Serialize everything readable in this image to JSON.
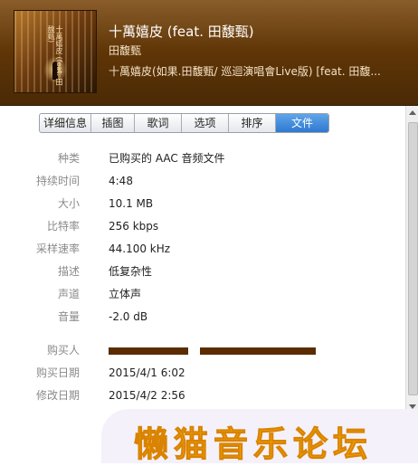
{
  "header": {
    "title": "十萬嬉皮 (feat. 田馥甄)",
    "artist": "田馥甄",
    "album": "十萬嬉皮(如果.田馥甄/ 巡迴演唱會Live版) [feat. 田馥..."
  },
  "tabs": [
    {
      "label": "详细信息"
    },
    {
      "label": "插图"
    },
    {
      "label": "歌词"
    },
    {
      "label": "选项"
    },
    {
      "label": "排序"
    },
    {
      "label": "文件",
      "active": true
    }
  ],
  "fields": [
    {
      "label": "种类",
      "value": "已购买的 AAC 音频文件"
    },
    {
      "label": "持续时间",
      "value": "4:48"
    },
    {
      "label": "大小",
      "value": "10.1 MB"
    },
    {
      "label": "比特率",
      "value": "256 kbps"
    },
    {
      "label": "采样速率",
      "value": "44.100 kHz"
    },
    {
      "label": "描述",
      "value": "低复杂性"
    },
    {
      "label": "声道",
      "value": "立体声"
    },
    {
      "label": "音量",
      "value": "-2.0 dB"
    }
  ],
  "purchase": {
    "buyer_label": "购买人",
    "purchase_date_label": "购买日期",
    "purchase_date": "2015/4/1 6:02",
    "modified_date_label": "修改日期",
    "modified_date": "2015/4/2 2:56"
  },
  "watermark": {
    "text": "懒猫音乐论坛"
  },
  "colors": {
    "header_brown": "#5d3406",
    "active_tab": "#3a86d8",
    "redaction": "#5a2c00",
    "watermark": "#f5a600"
  }
}
